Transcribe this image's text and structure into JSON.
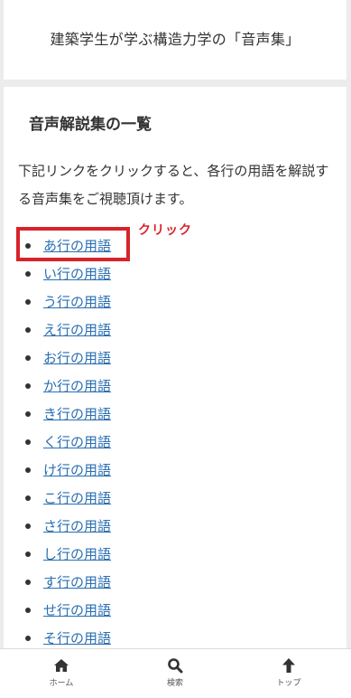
{
  "header": {
    "title": "建築学生が学ぶ構造力学の「音声集」"
  },
  "main": {
    "heading": "音声解説集の一覧",
    "intro": "下記リンクをクリックすると、各行の用語を解説する音声集をご視聴頂けます。",
    "annotation": "クリック",
    "terms": [
      "あ行の用語",
      "い行の用語",
      "う行の用語",
      "え行の用語",
      "お行の用語",
      "か行の用語",
      "き行の用語",
      "く行の用語",
      "け行の用語",
      "こ行の用語",
      "さ行の用語",
      "し行の用語",
      "す行の用語",
      "せ行の用語",
      "そ行の用語"
    ]
  },
  "bottom_nav": {
    "items": [
      {
        "label": "ホーム",
        "icon": "home-icon"
      },
      {
        "label": "検索",
        "icon": "search-icon"
      },
      {
        "label": "トップ",
        "icon": "arrow-up-icon"
      }
    ]
  },
  "colors": {
    "link": "#2a6fb3",
    "highlight": "#d8232a",
    "background": "#ececec"
  }
}
